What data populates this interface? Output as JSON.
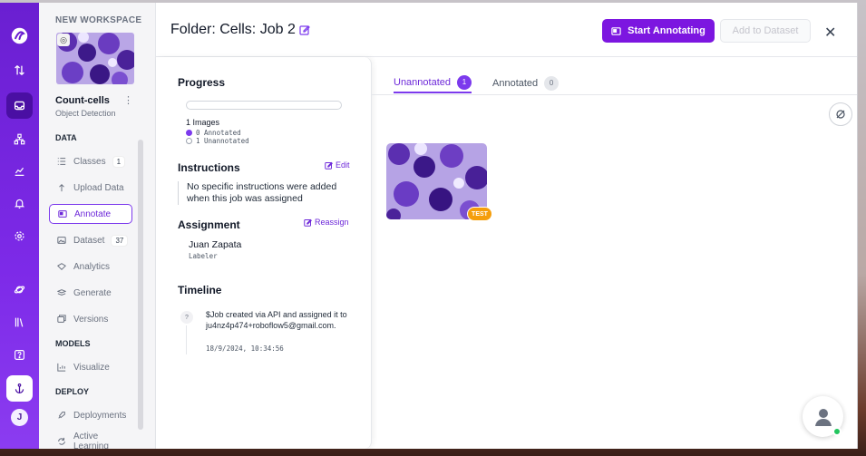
{
  "workspace": {
    "label": "NEW WORKSPACE"
  },
  "project": {
    "name": "Count-cells",
    "type": "Object Detection"
  },
  "sidebar": {
    "sections": [
      {
        "label": "DATA"
      },
      {
        "label": "MODELS"
      },
      {
        "label": "DEPLOY"
      }
    ],
    "items": [
      {
        "label": "Classes",
        "badge": "1",
        "icon": "list-icon"
      },
      {
        "label": "Upload Data",
        "icon": "upload-icon"
      },
      {
        "label": "Annotate",
        "icon": "annotate-icon",
        "active": true
      },
      {
        "label": "Dataset",
        "badge": "37",
        "icon": "image-icon"
      },
      {
        "label": "Analytics",
        "icon": "analytics-icon"
      },
      {
        "label": "Generate",
        "icon": "generate-icon"
      },
      {
        "label": "Versions",
        "icon": "versions-icon"
      },
      {
        "label": "Visualize",
        "icon": "chart-icon"
      },
      {
        "label": "Deployments",
        "icon": "rocket-icon"
      },
      {
        "label": "Active Learning",
        "icon": "loop-icon"
      }
    ]
  },
  "rail": {
    "avatar_initial": "J"
  },
  "header": {
    "title": "Folder: Cells: Job 2",
    "start_button": "Start Annotating",
    "add_button": "Add to Dataset"
  },
  "progress": {
    "heading": "Progress",
    "images": "1 Images",
    "annotated": "0 Annotated",
    "unannotated": "1 Unannotated",
    "fraction_annotated": 0
  },
  "instructions": {
    "heading": "Instructions",
    "edit_label": "Edit",
    "text": "No specific instructions were added when this job was assigned"
  },
  "assignment": {
    "heading": "Assignment",
    "reassign_label": "Reassign",
    "name": "Juan Zapata",
    "role": "Labeler"
  },
  "timeline": {
    "heading": "Timeline",
    "marker": "?",
    "event": "$Job created via API and assigned it to ju4nz4p474+roboflow5@gmail.com.",
    "time": "18/9/2024, 10:34:56"
  },
  "tabs": [
    {
      "label": "Unannotated",
      "count": "1"
    },
    {
      "label": "Annotated",
      "count": "0"
    }
  ],
  "image_tile": {
    "badge": "TEST"
  },
  "colors": {
    "brand": "#7c16e0",
    "rail": "#6a1fd1",
    "badge": "#f59e0b"
  }
}
